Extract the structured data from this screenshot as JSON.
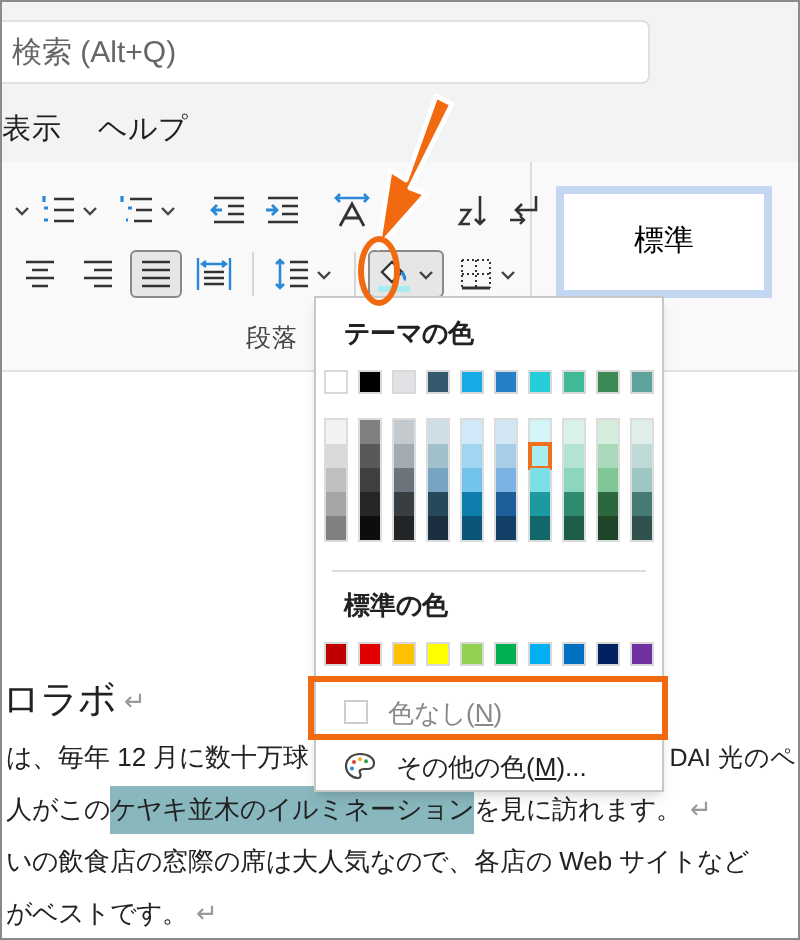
{
  "search": {
    "placeholder": "検索 (Alt+Q)"
  },
  "menu": [
    {
      "label": "表示"
    },
    {
      "label": "ヘルプ"
    }
  ],
  "ribbon": {
    "row_1": [
      {
        "kind": "caret"
      },
      {
        "kind": "numbering",
        "caret": true
      },
      {
        "kind": "multilevel",
        "caret": true
      },
      {
        "kind": "divider"
      },
      {
        "kind": "outdent"
      },
      {
        "kind": "indent"
      },
      {
        "kind": "divider"
      },
      {
        "kind": "asian-layout"
      },
      {
        "kind": "sort"
      },
      {
        "kind": "show-marks"
      }
    ],
    "row_2": [
      {
        "kind": "align-center",
        "selected": false
      },
      {
        "kind": "align-right",
        "selected": false
      },
      {
        "kind": "justify",
        "selected": true
      },
      {
        "kind": "distributed",
        "selected": false
      },
      {
        "kind": "divider"
      },
      {
        "kind": "line-spacing",
        "selected": false,
        "caret": true
      },
      {
        "kind": "divider"
      },
      {
        "kind": "shading",
        "selected": true,
        "caret": true
      },
      {
        "kind": "borders",
        "selected": false,
        "caret": true
      }
    ],
    "group_label": "段落",
    "styles": [
      {
        "label": "標準",
        "selected": true
      }
    ]
  },
  "shading_menu": {
    "theme_title": "テーマの色",
    "theme_base": [
      {
        "color": "#ffffff",
        "selected": false
      },
      {
        "color": "#000000",
        "selected": false
      },
      {
        "color": "#e1e2e6",
        "selected": false
      },
      {
        "color": "#355a6d",
        "selected": false
      },
      {
        "color": "#16aae8",
        "selected": false
      },
      {
        "color": "#2580c8",
        "selected": false
      },
      {
        "color": "#26ccd6",
        "selected": false
      },
      {
        "color": "#3fb996",
        "selected": false
      },
      {
        "color": "#3b8a55",
        "selected": false
      },
      {
        "color": "#5fa39c",
        "selected": false
      }
    ],
    "theme_shades": [
      [
        {
          "color": "#f2f2f2",
          "selected": false
        },
        {
          "color": "#d9d9d9",
          "selected": false
        },
        {
          "color": "#bfbfbf",
          "selected": false
        },
        {
          "color": "#a6a6a6",
          "selected": false
        },
        {
          "color": "#808080",
          "selected": false
        }
      ],
      [
        {
          "color": "#808080",
          "selected": false
        },
        {
          "color": "#595959",
          "selected": false
        },
        {
          "color": "#404040",
          "selected": false
        },
        {
          "color": "#262626",
          "selected": false
        },
        {
          "color": "#0d0d0d",
          "selected": false
        }
      ],
      [
        {
          "color": "#c4c9cd",
          "selected": false
        },
        {
          "color": "#a3abb2",
          "selected": false
        },
        {
          "color": "#6b747c",
          "selected": false
        },
        {
          "color": "#393e42",
          "selected": false
        },
        {
          "color": "#222528",
          "selected": false
        }
      ],
      [
        {
          "color": "#cfdde7",
          "selected": false
        },
        {
          "color": "#a0c0cc",
          "selected": false
        },
        {
          "color": "#76a4c2",
          "selected": false
        },
        {
          "color": "#27495c",
          "selected": false
        },
        {
          "color": "#1b2f40",
          "selected": false
        }
      ],
      [
        {
          "color": "#d0e8f7",
          "selected": false
        },
        {
          "color": "#a2d5f3",
          "selected": false
        },
        {
          "color": "#72c4ea",
          "selected": false
        },
        {
          "color": "#0e7fad",
          "selected": false
        },
        {
          "color": "#095678",
          "selected": false
        }
      ],
      [
        {
          "color": "#d3e6f4",
          "selected": false
        },
        {
          "color": "#a8cde9",
          "selected": false
        },
        {
          "color": "#7cb3e2",
          "selected": false
        },
        {
          "color": "#1c5f99",
          "selected": false
        },
        {
          "color": "#123f66",
          "selected": false
        }
      ],
      [
        {
          "color": "#d4f5f7",
          "selected": false
        },
        {
          "color": "#a9ecef",
          "selected": true
        },
        {
          "color": "#7ddfe6",
          "selected": false
        },
        {
          "color": "#1b9aa1",
          "selected": false
        },
        {
          "color": "#12676b",
          "selected": false
        }
      ],
      [
        {
          "color": "#d9f1ea",
          "selected": false
        },
        {
          "color": "#b2e3d5",
          "selected": false
        },
        {
          "color": "#8cd6c0",
          "selected": false
        },
        {
          "color": "#2e8b70",
          "selected": false
        },
        {
          "color": "#1f5d4b",
          "selected": false
        }
      ],
      [
        {
          "color": "#d6eddd",
          "selected": false
        },
        {
          "color": "#aad9b9",
          "selected": false
        },
        {
          "color": "#80c797",
          "selected": false
        },
        {
          "color": "#2c6740",
          "selected": false
        },
        {
          "color": "#1d452a",
          "selected": false
        }
      ],
      [
        {
          "color": "#dfedeb",
          "selected": false
        },
        {
          "color": "#bfd9d6",
          "selected": false
        },
        {
          "color": "#9ec7c3",
          "selected": false
        },
        {
          "color": "#467b75",
          "selected": false
        },
        {
          "color": "#2f524e",
          "selected": false
        }
      ]
    ],
    "standard_title": "標準の色",
    "standard": [
      {
        "color": "#c00000",
        "selected": false
      },
      {
        "color": "#e00000",
        "selected": false
      },
      {
        "color": "#ffc000",
        "selected": false
      },
      {
        "color": "#ffff00",
        "selected": false
      },
      {
        "color": "#92d050",
        "selected": false
      },
      {
        "color": "#00b050",
        "selected": false
      },
      {
        "color": "#00b0f0",
        "selected": false
      },
      {
        "color": "#0070c0",
        "selected": false
      },
      {
        "color": "#002060",
        "selected": false
      },
      {
        "color": "#7030a0",
        "selected": false
      }
    ],
    "items": [
      {
        "kind": "no-color",
        "before": "色なし(",
        "key": "N",
        "after": ")",
        "disabled": true
      },
      {
        "kind": "more-colors",
        "before": "その他の色(",
        "key": "M",
        "after": ")...",
        "disabled": false
      }
    ]
  },
  "document": {
    "heading": {
      "text": "ロラボ",
      "mark": "↵"
    },
    "lines": [
      {
        "kind": "split",
        "left": "は、毎年 12 月に数十万球",
        "right": "DAI 光のペ"
      },
      {
        "kind": "plain",
        "segments": [
          {
            "text": "人がこの",
            "highlight": false
          },
          {
            "text": "ケヤキ並木のイルミネーション",
            "highlight": true
          },
          {
            "text": "を見に訪れます。",
            "highlight": false
          }
        ],
        "mark": "↵"
      },
      {
        "kind": "plain",
        "segments": [
          {
            "text": "いの飲食店の窓際の席は大人気なので、各店の Web サイトなど",
            "highlight": false
          }
        ]
      },
      {
        "kind": "plain",
        "segments": [
          {
            "text": "がベストです。",
            "highlight": false
          }
        ],
        "mark": "↵"
      }
    ]
  },
  "annotations": [
    {
      "kind": "arrow"
    },
    {
      "kind": "ellipse"
    },
    {
      "kind": "frame"
    }
  ]
}
